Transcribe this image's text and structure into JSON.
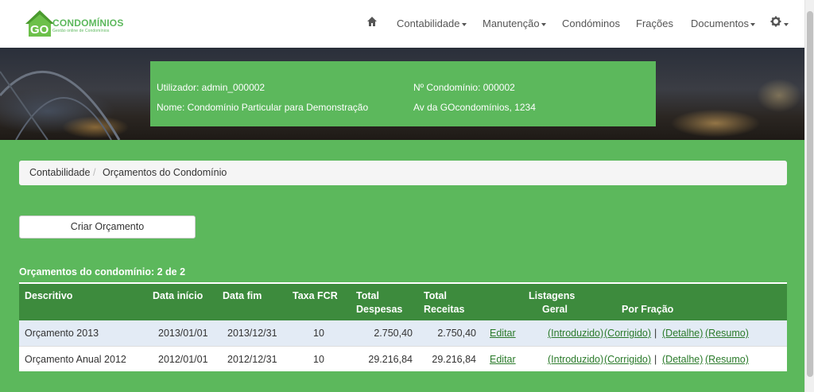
{
  "brand": {
    "name": "CONDOMÍNIOS",
    "prefix": "GO",
    "tagline": "Gestão online de Condomínios"
  },
  "nav": {
    "home_icon": "home-icon",
    "items": [
      "Contabilidade",
      "Manutenção",
      "Condóminos",
      "Frações",
      "Documentos"
    ],
    "settings_icon": "gear-icon"
  },
  "info": {
    "user": "Utilizador: admin_000002",
    "condo_number": "Nº Condomínio: 000002",
    "name": "Nome: Condomínio Particular para Demonstração",
    "address": "Av da GOcondomínios, 1234"
  },
  "breadcrumb": {
    "parent": "Contabilidade",
    "separator": "/",
    "current": "Orçamentos do Condomínio"
  },
  "create_button": "Criar Orçamento",
  "table": {
    "caption": "Orçamentos do condomínio: 2 de 2",
    "headers": {
      "descritivo": "Descritivo",
      "data_inicio": "Data início",
      "data_fim": "Data fim",
      "taxa_fcr": "Taxa FCR",
      "total_despesas_1": "Total",
      "total_despesas_2": "Despesas",
      "total_receitas_1": "Total",
      "total_receitas_2": "Receitas",
      "listagens_1": "Listagens",
      "listagens_2": "Geral",
      "por_fracao": "Por Fração"
    },
    "rows": [
      {
        "descritivo": "Orçamento 2013",
        "data_inicio": "2013/01/01",
        "data_fim": "2013/12/31",
        "taxa_fcr": "10",
        "total_despesas": "2.750,40",
        "total_receitas": "2.750,40",
        "edit": "Editar",
        "introduzido": "(Introduzido)",
        "corrigido": "(Corrigido)",
        "pipe": "|",
        "detalhe": "(Detalhe)",
        "resumo": "(Resumo)"
      },
      {
        "descritivo": "Orçamento Anual 2012",
        "data_inicio": "2012/01/01",
        "data_fim": "2012/12/31",
        "taxa_fcr": "10",
        "total_despesas": "29.216,84",
        "total_receitas": "29.216,84",
        "edit": "Editar",
        "introduzido": "(Introduzido)",
        "corrigido": "(Corrigido)",
        "pipe": "|",
        "detalhe": "(Detalhe)",
        "resumo": "(Resumo)"
      }
    ]
  },
  "colors": {
    "primary": "#5cb85c",
    "header": "#3d8b3d",
    "row_highlight": "#e3ebf5",
    "link": "#2a7a2a"
  }
}
